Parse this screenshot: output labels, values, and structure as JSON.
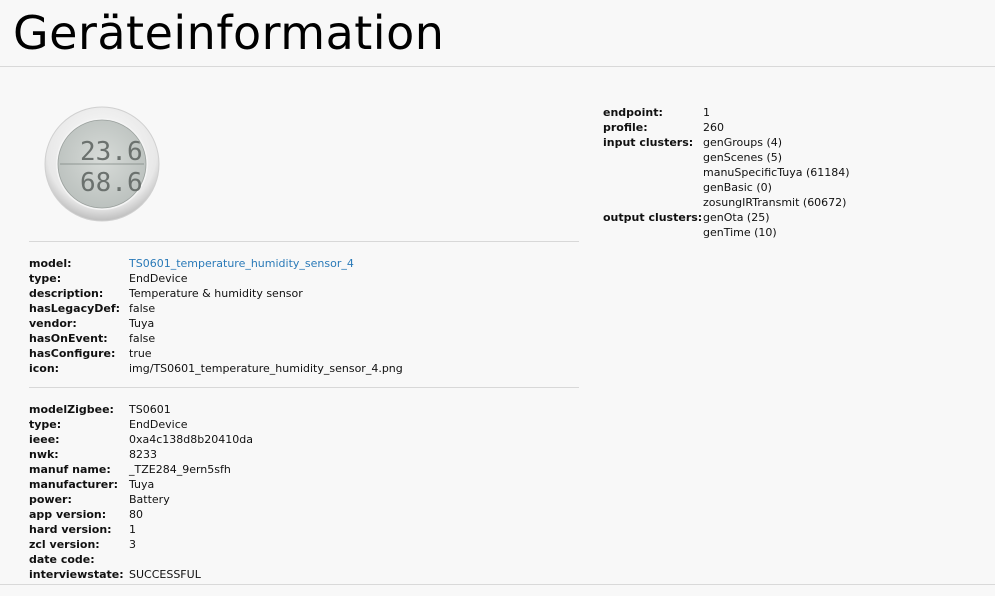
{
  "page": {
    "title": "Geräteinformation"
  },
  "device_icon": "thermo-hygrometer-device-image",
  "device_display": {
    "temperature": "23.6",
    "humidity": "68.6"
  },
  "model_info": [
    {
      "label": "model:",
      "value": "TS0601_temperature_humidity_sensor_4"
    },
    {
      "label": "type:",
      "value": "EndDevice"
    },
    {
      "label": "description:",
      "value": "Temperature & humidity sensor"
    },
    {
      "label": "hasLegacyDef:",
      "value": "false"
    },
    {
      "label": "vendor:",
      "value": "Tuya"
    },
    {
      "label": "hasOnEvent:",
      "value": "false"
    },
    {
      "label": "hasConfigure:",
      "value": "true"
    },
    {
      "label": "icon:",
      "value": "img/TS0601_temperature_humidity_sensor_4.png"
    }
  ],
  "zigbee_info": [
    {
      "label": "modelZigbee:",
      "value": "TS0601"
    },
    {
      "label": "type:",
      "value": "EndDevice"
    },
    {
      "label": "ieee:",
      "value": "0xa4c138d8b20410da"
    },
    {
      "label": "nwk:",
      "value": "8233"
    },
    {
      "label": "manuf name:",
      "value": "_TZE284_9ern5sfh"
    },
    {
      "label": "manufacturer:",
      "value": "Tuya"
    },
    {
      "label": "power:",
      "value": "Battery"
    },
    {
      "label": "app version:",
      "value": "80"
    },
    {
      "label": "hard version:",
      "value": "1"
    },
    {
      "label": "zcl version:",
      "value": "3"
    },
    {
      "label": "date code:",
      "value": ""
    },
    {
      "label": "interviewstate:",
      "value": "SUCCESSFUL"
    }
  ],
  "endpoint": {
    "endpoint_label": "endpoint:",
    "endpoint": "1",
    "profile_label": "profile:",
    "profile": "260",
    "input_label": "input clusters:",
    "input_clusters": [
      "genGroups (4)",
      "genScenes (5)",
      "manuSpecificTuya (61184)",
      "genBasic (0)",
      "zosungIRTransmit (60672)"
    ],
    "output_label": "output clusters:",
    "output_clusters": [
      "genOta (25)",
      "genTime (10)"
    ]
  }
}
